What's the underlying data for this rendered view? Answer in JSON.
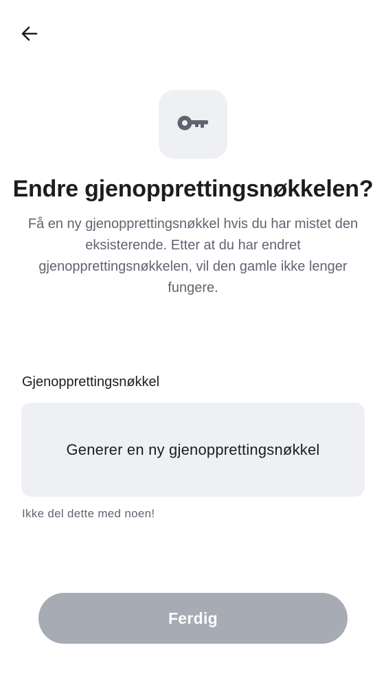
{
  "header": {
    "back_icon": "arrow-left-icon"
  },
  "hero": {
    "icon": "key-icon",
    "title": "Endre gjenopprettingsnøkkelen?",
    "description": "Få en ny gjenopprettingsnøkkel hvis du har mistet den eksisterende. Etter at du har endret gjenopprettingsnøkkelen, vil den gamle ikke lenger fungere."
  },
  "field": {
    "label": "Gjenopprettingsnøkkel",
    "generate_label": "Generer en ny gjenopprettingsnøkkel",
    "hint": "Ikke del dette med noen!"
  },
  "footer": {
    "done_label": "Ferdig",
    "done_enabled": false
  },
  "colors": {
    "tile_background": "#eff0f4",
    "title_text": "#1c1d21",
    "secondary_text": "#5f6470",
    "disabled_button": "#a6abb4"
  }
}
